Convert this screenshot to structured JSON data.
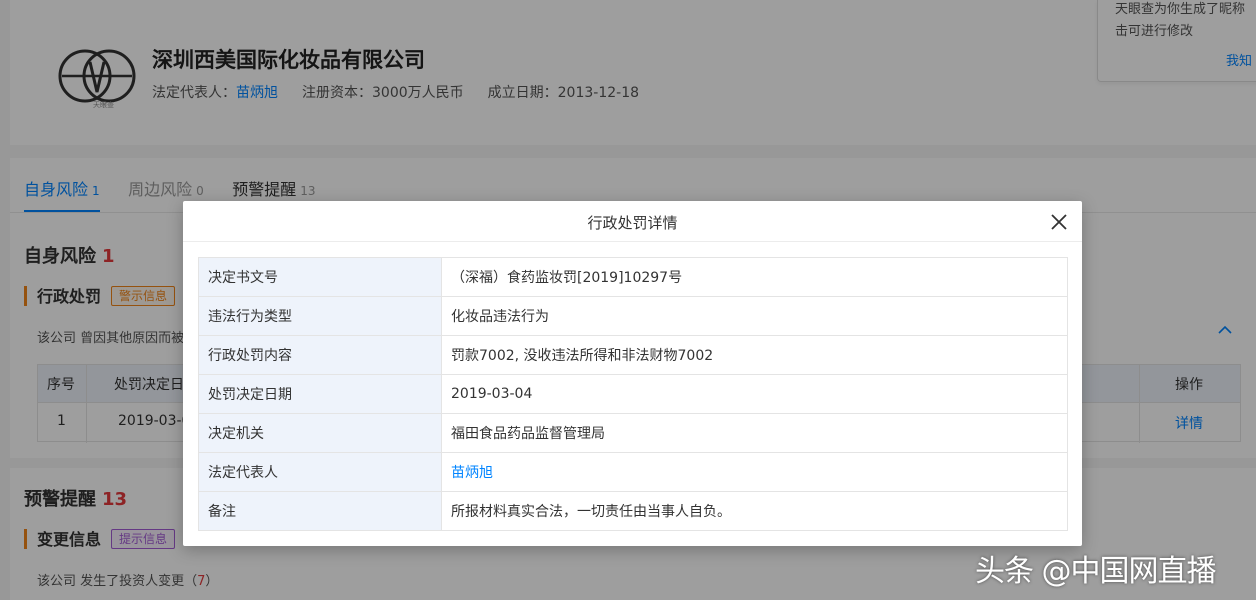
{
  "company": {
    "name": "深圳西美国际化妆品有限公司",
    "logo_badge": "天眼查",
    "legal_rep_label": "法定代表人：",
    "legal_rep": "苗炳旭",
    "capital_label": "注册资本：",
    "capital": "3000万人民币",
    "founded_label": "成立日期：",
    "founded": "2013-12-18"
  },
  "nickname_tip": {
    "line1": "天眼查为你生成了昵称",
    "line2": "击可进行修改",
    "dismiss": "我知"
  },
  "tabs": [
    {
      "label": "自身风险",
      "count": "1"
    },
    {
      "label": "周边风险",
      "count": "0"
    },
    {
      "label": "预警提醒",
      "count": "13"
    }
  ],
  "self_risk": {
    "title": "自身风险",
    "count": "1",
    "admin_penalty": {
      "title": "行政处罚",
      "tag": "警示信息",
      "desc": "该公司 曾因其他原因而被"
    },
    "table": {
      "headers": [
        "序号",
        "处罚决定日",
        "操作"
      ],
      "row": {
        "index": "1",
        "date": "2019-03-0",
        "action": "详情"
      }
    }
  },
  "warning": {
    "title": "预警提醒",
    "count": "13",
    "change": {
      "title": "变更信息",
      "tag": "提示信息",
      "desc_prefix": "该公司 发生了投资人变更（",
      "desc_count": "7",
      "desc_suffix": "）"
    }
  },
  "modal": {
    "title": "行政处罚详情",
    "rows": [
      {
        "key": "决定书文号",
        "value": "（深福）食药监妆罚[2019]10297号"
      },
      {
        "key": "违法行为类型",
        "value": "化妆品违法行为"
      },
      {
        "key": "行政处罚内容",
        "value": "罚款7002, 没收违法所得和非法财物7002"
      },
      {
        "key": "处罚决定日期",
        "value": "2019-03-04"
      },
      {
        "key": "决定机关",
        "value": "福田食品药品监督管理局"
      },
      {
        "key": "法定代表人",
        "value": "苗炳旭"
      },
      {
        "key": "备注",
        "value": "所报材料真实合法，一切责任由当事人自负。"
      }
    ]
  },
  "watermark": "头条 @中国网直播",
  "colors": {
    "accent": "#0084ff",
    "danger": "#e4393c",
    "warn": "#f08519",
    "hint": "#a35cd6"
  }
}
